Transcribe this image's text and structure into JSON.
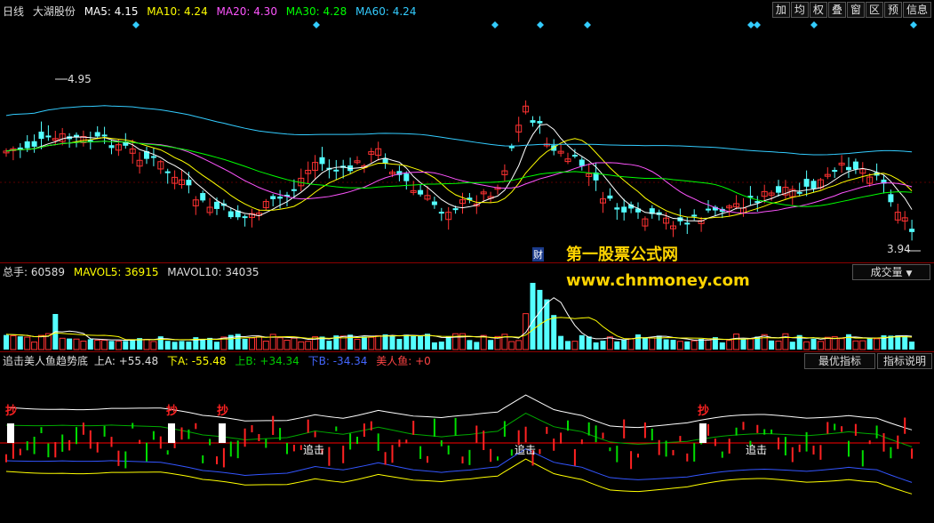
{
  "main_legend": {
    "period": "日线",
    "stock": "大湖股份",
    "ma5": "MA5: 4.15",
    "ma10": "MA10: 4.24",
    "ma20": "MA20: 4.30",
    "ma30": "MA30: 4.28",
    "ma60": "MA60: 4.24"
  },
  "toolbar": [
    "加",
    "均",
    "权",
    "叠",
    "窗",
    "区",
    "预",
    "信息"
  ],
  "price_labels": {
    "high": "4.95",
    "low": "3.94",
    "fin_marker": "财"
  },
  "volume_legend": {
    "total": "总手: 60589",
    "mavol5": "MAVOL5: 36915",
    "mavol10": "MAVOL10: 34035",
    "selector": "成交量"
  },
  "indicator_legend": {
    "name": "追击美人鱼趋势底",
    "upA": "上A: +55.48",
    "downA": "下A: -55.48",
    "upB": "上B: +34.34",
    "downB": "下B: -34.34",
    "mermaid": "美人鱼: +0",
    "best_button": "最优指标",
    "explain_button": "指标说明"
  },
  "signals": {
    "buy": "抄",
    "chase": "追击"
  },
  "watermark": {
    "title": "第一股票公式网",
    "url": "www.chnmoney.com"
  },
  "colors": {
    "ma5": "#ffffff",
    "ma10": "#ffff00",
    "ma20": "#ff55ff",
    "ma30": "#00ff00",
    "ma60": "#33ccff",
    "up": "#ff3232",
    "down": "#54ffff",
    "zero_line": "#ff0000"
  }
}
